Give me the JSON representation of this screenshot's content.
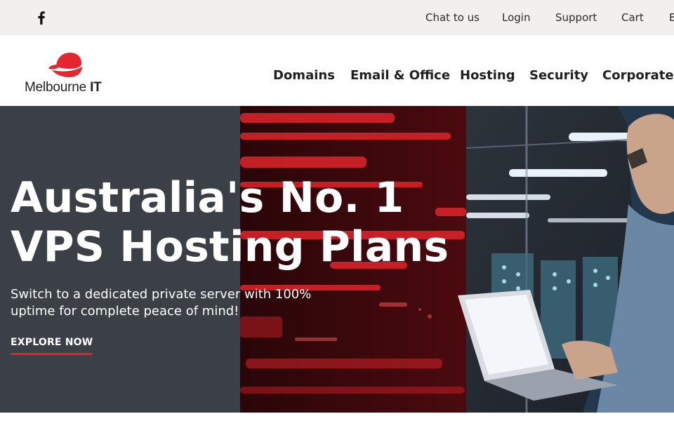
{
  "utility_bar": {
    "links": [
      "Chat to us",
      "Login",
      "Support",
      "Cart",
      "B"
    ]
  },
  "brand": {
    "name_regular": "Melbourne ",
    "name_bold": "IT",
    "logo_color": "#e3262f"
  },
  "nav": {
    "items": [
      "Domains",
      "Email & Office",
      "Hosting",
      "Security",
      "Corporate"
    ]
  },
  "hero": {
    "headline_line1": "Australia's No. 1",
    "headline_line2": "VPS Hosting Plans",
    "subtext": "Switch to a dedicated private server with 100% uptime for complete peace of mind!",
    "cta": "EXPLORE NOW",
    "accent_color": "#d7262e"
  },
  "icons": {
    "social": "facebook-icon"
  }
}
